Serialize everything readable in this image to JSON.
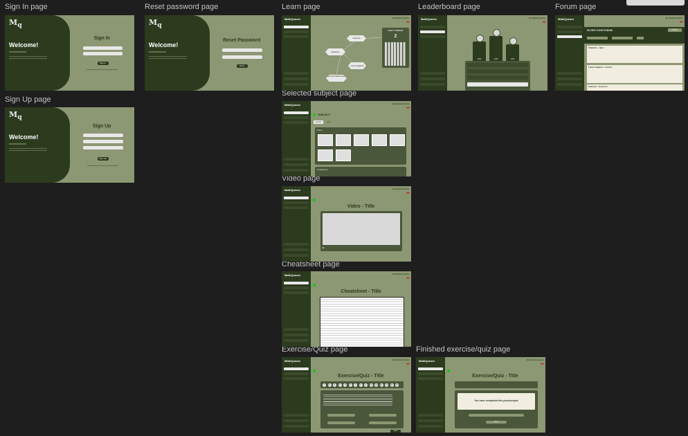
{
  "frames": {
    "sign_in": "Sign In page",
    "reset_password": "Reset password page",
    "learn": "Learn page",
    "leaderboard": "Leaderboard page",
    "forum": "Forum page",
    "sign_up": "Sign Up page",
    "selected_subject": "Selected subject page",
    "video": "Video page",
    "cheatsheet": "Cheatsheet page",
    "exercise_quiz": "Exercise/Quiz page",
    "finished_exercise": "Finished exercise/quiz page"
  },
  "auth": {
    "welcome": "Welcome!",
    "sign_in_title": "Sign In",
    "reset_title": "Reset Password",
    "sign_up_title": "Sign Up",
    "sign_in_button": "Sign In",
    "sign_up_button": "Sign Up",
    "send_button": "Send"
  },
  "app": {
    "logo": "MathQuesm",
    "user": "Hi, Student Astra",
    "hearts": "♥♥♥"
  },
  "learn": {
    "daily_streak_label": "DAILY STREAK",
    "daily_streak_value": "2",
    "subjects": [
      "Calculus",
      "Statistics",
      "Linear Algebra",
      "Discrete Mathematics"
    ]
  },
  "leaderboard": {
    "podium": [
      "Username",
      "Username",
      "Username"
    ],
    "podium_scores": [
      "1234",
      "1234",
      "1234"
    ]
  },
  "forum": {
    "filter_title": "FILTER YOUR FORUM",
    "post_button": "POST",
    "cards": [
      "Statistics - Quiz",
      "Linear Algebra - Lecture",
      "Calculus - Exercise"
    ]
  },
  "subject": {
    "title": "SUBJECT",
    "tabs": [
      "Lecture",
      "Quiz"
    ],
    "video_section": "Video",
    "cheatsheet_section": "Cheatsheet"
  },
  "video": {
    "title": "Video - Title"
  },
  "cheatsheet": {
    "title": "Cheatsheet - Title"
  },
  "exercise": {
    "title": "Exercise/Quiz - Title",
    "numbers": [
      "1",
      "2",
      "3",
      "4",
      "5",
      "6",
      "7",
      "8",
      "9",
      "10",
      "11",
      "12",
      "13",
      "14",
      "15"
    ],
    "next": "Next"
  },
  "finished": {
    "title": "Exercise/Quiz - Title",
    "message": "You have completed this practice/quiz",
    "back": "Back"
  }
}
